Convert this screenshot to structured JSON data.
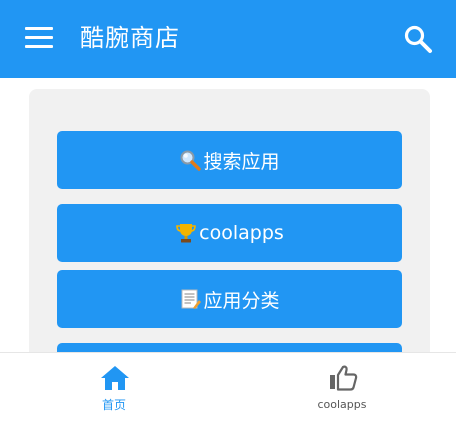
{
  "appbar": {
    "title": "酷腕商店",
    "menu_icon": "menu-icon",
    "search_icon": "search-icon",
    "color": "#2196F3"
  },
  "menu": {
    "buttons": [
      {
        "icon": "magnifier-emoji",
        "label": "搜索应用"
      },
      {
        "icon": "trophy-emoji",
        "label": "coolapps"
      },
      {
        "icon": "memo-emoji",
        "label": "应用分类"
      },
      {
        "icon": "",
        "label": ""
      }
    ]
  },
  "bottom_nav": {
    "items": [
      {
        "icon": "home-icon",
        "label": "首页",
        "active": true
      },
      {
        "icon": "thumbs-up-icon",
        "label": "coolapps",
        "active": false
      }
    ],
    "active_color": "#2196F3"
  }
}
